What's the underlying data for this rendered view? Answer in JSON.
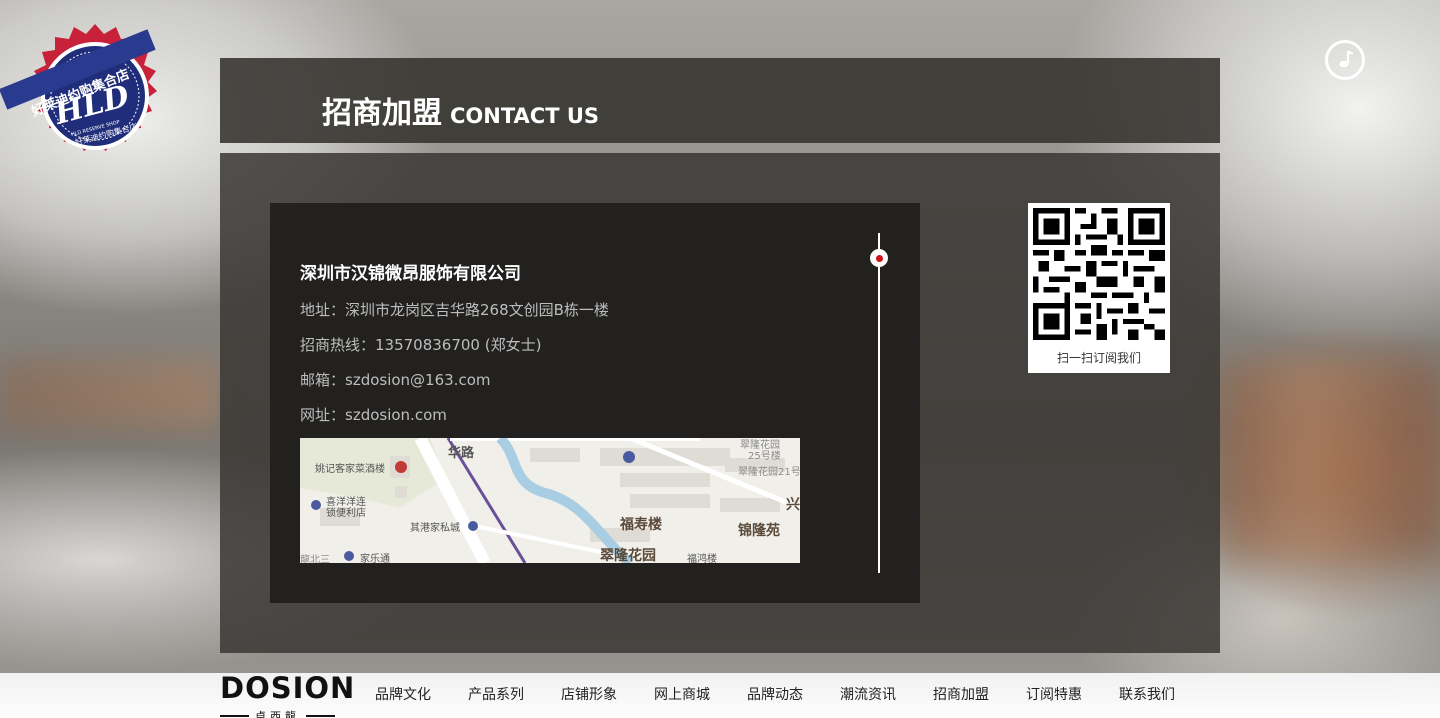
{
  "badge": {
    "arc_text": "好莱迪约购集合店",
    "initials": "HLD",
    "sub_en": "HLD RESERVE SHOP",
    "sub_cn": "好莱迪约购集合店"
  },
  "header": {
    "title_cn": "招商加盟",
    "title_en": "CONTACT US"
  },
  "contact": {
    "company": "深圳市汉锦微昂服饰有限公司",
    "address": "地址：深圳市龙岗区吉华路268文创园B栋一楼",
    "hotline": "招商热线：13570836700 (郑女士)",
    "email": "邮箱：szdosion@163.com",
    "website": "网址：szdosion.com"
  },
  "map": {
    "labels": {
      "restaurant": "姚记客家菜酒楼",
      "store": "喜洋洋连",
      "store2": "锁便利店",
      "shop": "其港家私城",
      "jiale": "家乐通",
      "fushou": "福寿楼",
      "cuilong": "翠隆花园",
      "jinlong": "锦隆苑",
      "fuhong": "福鸿楼",
      "road": "华路",
      "cui25": "翠隆花园",
      "cui25b": "25号楼",
      "cui21": "翠隆花园21号",
      "bei": "龍北三",
      "xing": "兴"
    },
    "colors": {
      "water": "#a9cde3",
      "road": "#6a4f9a",
      "block": "#dedcd5"
    }
  },
  "qr": {
    "caption": "扫一扫订阅我们"
  },
  "footer": {
    "brand": "DOSION",
    "brand_sub": "卓西龍",
    "nav": [
      "品牌文化",
      "产品系列",
      "店铺形象",
      "网上商城",
      "品牌动态",
      "潮流资讯",
      "招商加盟",
      "订阅特惠",
      "联系我们"
    ]
  },
  "colors": {
    "accent": "#d0101a",
    "badge_blue": "#1f2d7a",
    "badge_red": "#c8213a"
  }
}
